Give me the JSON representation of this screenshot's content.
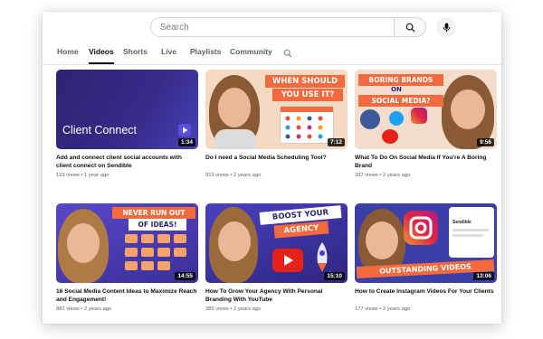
{
  "search": {
    "placeholder": "Search"
  },
  "tabs": [
    {
      "label": "Home"
    },
    {
      "label": "Videos",
      "active": true
    },
    {
      "label": "Shorts"
    },
    {
      "label": "Live"
    },
    {
      "label": "Playlists"
    },
    {
      "label": "Community"
    }
  ],
  "videos": [
    {
      "title": "Add and connect client social accounts with client connect on Sendible",
      "views": "193 views",
      "age": "1 year ago",
      "duration": "1:34",
      "thumb_text": "Client Connect"
    },
    {
      "title": "Do I need a Social Media Scheduling Tool?",
      "views": "913 views",
      "age": "2 years ago",
      "duration": "7:12",
      "thumb_text": [
        "WHEN SHOULD",
        "YOU USE IT?"
      ]
    },
    {
      "title": "What To Do On Social Media If You're A Boring Brand",
      "views": "397 views",
      "age": "2 years ago",
      "duration": "9:56",
      "thumb_text": [
        "BORING BRANDS",
        "ON",
        "SOCIAL MEDIA?"
      ]
    },
    {
      "title": "16 Social Media Content Ideas to Maximize Reach and Engagement!",
      "views": "882 views",
      "age": "2 years ago",
      "duration": "14:55",
      "thumb_text": [
        "NEVER RUN OUT",
        "OF IDEAS!"
      ]
    },
    {
      "title": "How To Grow Your Agency With Personal Branding With YouTube",
      "views": "385 views",
      "age": "2 years ago",
      "duration": "15:10",
      "thumb_text": [
        "BOOST YOUR",
        "AGENCY"
      ]
    },
    {
      "title": "How to Create Instagram Videos For Your Clients",
      "views": "177 views",
      "age": "2 years ago",
      "duration": "13:06",
      "thumb_text": [
        "OUTSTANDING VIDEOS",
        "Sendible"
      ]
    }
  ],
  "colors": {
    "thumb_dark": "#2a2470",
    "banner_orange": "#f26a3d",
    "brand_blue": "#3b5bdb"
  }
}
